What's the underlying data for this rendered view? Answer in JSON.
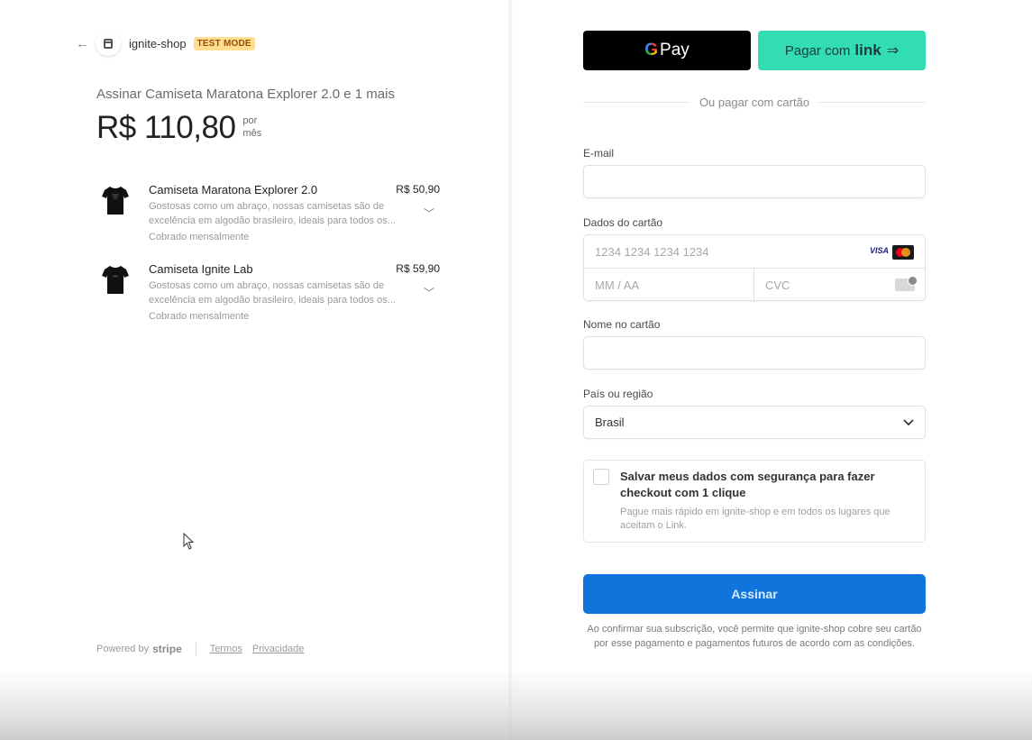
{
  "header": {
    "back_icon": "arrow-left-icon",
    "shop_icon": "store-icon",
    "shop_name": "ignite-shop",
    "badge": "TEST MODE"
  },
  "summary": {
    "title": "Assinar Camiseta Maratona Explorer 2.0 e 1 mais",
    "price": "R$ 110,80",
    "per_line1": "por",
    "per_line2": "mês"
  },
  "items": [
    {
      "name": "Camiseta Maratona Explorer 2.0",
      "amount": "R$ 50,90",
      "desc_line1": "Gostosas como um abraço, nossas camisetas são de",
      "desc_line2": "excelência em algodão brasileiro, ideais para todos os...",
      "billing": "Cobrado mensalmente",
      "icon": "tshirt-icon"
    },
    {
      "name": "Camiseta Ignite Lab",
      "amount": "R$ 59,90",
      "desc_line1": "Gostosas como um abraço, nossas camisetas são de",
      "desc_line2": "excelência em algodão brasileiro, ideais para todos os...",
      "billing": "Cobrado mensalmente",
      "icon": "tshirt-icon"
    }
  ],
  "footer": {
    "powered_by": "Powered by",
    "brand": "stripe",
    "terms": "Termos",
    "privacy": "Privacidade"
  },
  "payment": {
    "gpay_g": "G",
    "gpay_label": "Pay",
    "link_prefix": "Pagar com",
    "link_brand": "link",
    "link_arrow": "⇒",
    "or_text": "Ou pagar com cartão",
    "email_label": "E-mail",
    "email_value": "",
    "card_label": "Dados do cartão",
    "card_number_placeholder": "1234 1234 1234 1234",
    "visa_text": "VISA",
    "expiry_placeholder": "MM / AA",
    "cvc_placeholder": "CVC",
    "name_label": "Nome no cartão",
    "name_value": "",
    "country_label": "País ou região",
    "country_value": "Brasil",
    "save_title": "Salvar meus dados com segurança para fazer checkout com 1 clique",
    "save_desc": "Pague mais rápido em ignite-shop e em todos os lugares que aceitam o Link.",
    "submit_label": "Assinar",
    "legal": "Ao confirmar sua subscrição, você permite que ignite-shop cobre seu cartão por esse pagamento e pagamentos futuros de acordo com as condições."
  },
  "colors": {
    "badge_bg": "#ffde92",
    "link_bg": "#33ddb3",
    "submit_bg": "#0f74dc"
  }
}
